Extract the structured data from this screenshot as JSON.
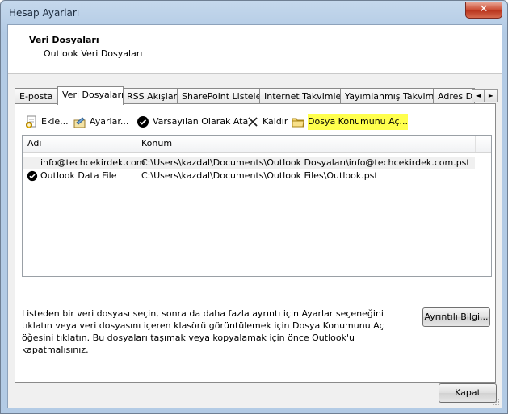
{
  "window": {
    "title": "Hesap Ayarları",
    "close_label": "✕"
  },
  "header": {
    "title": "Veri Dosyaları",
    "subtitle": "Outlook Veri Dosyaları"
  },
  "tabs": [
    {
      "label": "E-posta"
    },
    {
      "label": "Veri Dosyaları"
    },
    {
      "label": "RSS Akışları"
    },
    {
      "label": "SharePoint Listeleri"
    },
    {
      "label": "Internet Takvimleri"
    },
    {
      "label": "Yayımlanmış Takvimler"
    },
    {
      "label": "Adres De"
    }
  ],
  "tab_scroll": {
    "left": "◄",
    "right": "►"
  },
  "toolbar": {
    "add": "Ekle...",
    "settings": "Ayarlar...",
    "set_default": "Varsayılan Olarak Ata",
    "remove": "Kaldır",
    "open_location": "Dosya Konumunu Aç..."
  },
  "list": {
    "columns": [
      "Adı",
      "Konum"
    ],
    "rows": [
      {
        "name": "info@techcekirdek.com",
        "location": "C:\\Users\\kazdal\\Documents\\Outlook Dosyaları\\info@techcekirdek.com.pst",
        "default": false
      },
      {
        "name": "Outlook Data File",
        "location": "C:\\Users\\kazdal\\Documents\\Outlook Files\\Outlook.pst",
        "default": true
      }
    ]
  },
  "description": "Listeden bir veri dosyası seçin, sonra da daha fazla ayrıntı için Ayarlar seçeneğini tıklatın veya veri dosyasını içeren klasörü görüntülemek için Dosya Konumunu Aç öğesini tıklatın. Bu dosyaları taşımak veya kopyalamak için önce Outlook'u kapatmalısınız.",
  "details_button": "Ayrıntılı Bilgi...",
  "close_button": "Kapat",
  "colors": {
    "highlight": "#ffff4d",
    "title_bar": "#c5d8ec"
  }
}
